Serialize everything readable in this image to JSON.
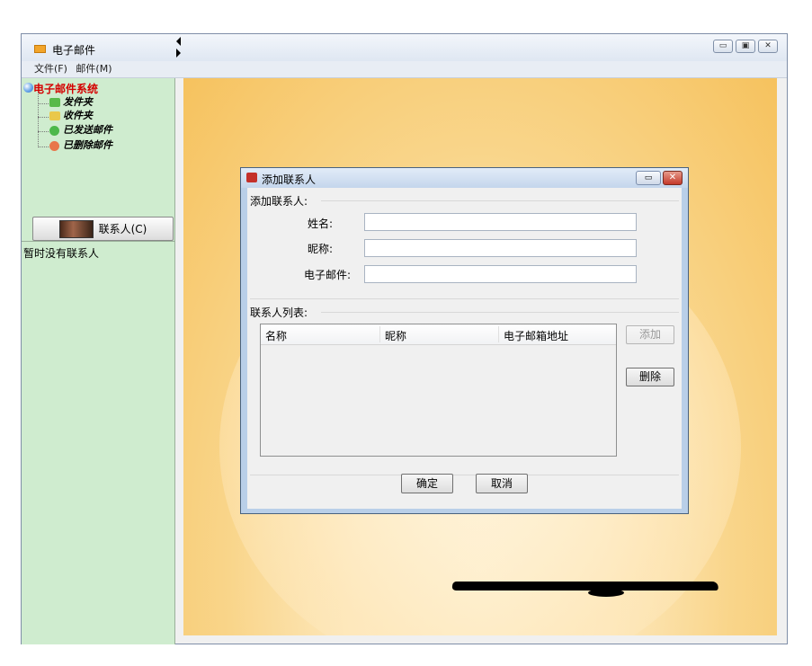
{
  "window": {
    "title": "电子邮件",
    "buttons": {
      "minimize": "▭",
      "maximize": "▣",
      "close": "✕"
    }
  },
  "menu": {
    "items": [
      {
        "label": "文件(F)"
      },
      {
        "label": "邮件(M)"
      }
    ]
  },
  "sidebar": {
    "tree_root": "电子邮件系统",
    "tree_items": [
      {
        "label": "发件夹",
        "icon": "outbox-folder-icon",
        "color": "#58b94a"
      },
      {
        "label": "收件夹",
        "icon": "inbox-folder-icon",
        "color": "#e9c84a"
      },
      {
        "label": "已发送邮件",
        "icon": "sent-check-icon",
        "color": "#4cb84a"
      },
      {
        "label": "已删除邮件",
        "icon": "deleted-icon",
        "color": "#e8764a"
      }
    ],
    "contacts_button": "联系人(C)",
    "contacts_empty": "暂时没有联系人"
  },
  "dialog": {
    "title": "添加联系人",
    "section_add": "添加联系人:",
    "fields": {
      "name_label": "姓名:",
      "name_value": "",
      "nickname_label": "昵称:",
      "nickname_value": "",
      "email_label": "电子邮件:",
      "email_value": ""
    },
    "section_list": "联系人列表:",
    "table": {
      "columns": [
        "名称",
        "昵称",
        "电子邮箱地址"
      ],
      "rows": []
    },
    "add_button": "添加",
    "delete_button": "删除",
    "ok_button": "确定",
    "cancel_button": "取消",
    "close_symbol": "✕",
    "min_symbol": "▭"
  },
  "colors": {
    "sidebar_bg": "#cfeccf",
    "root_text": "#d40000",
    "dialog_frame": "#b9cfe8"
  }
}
